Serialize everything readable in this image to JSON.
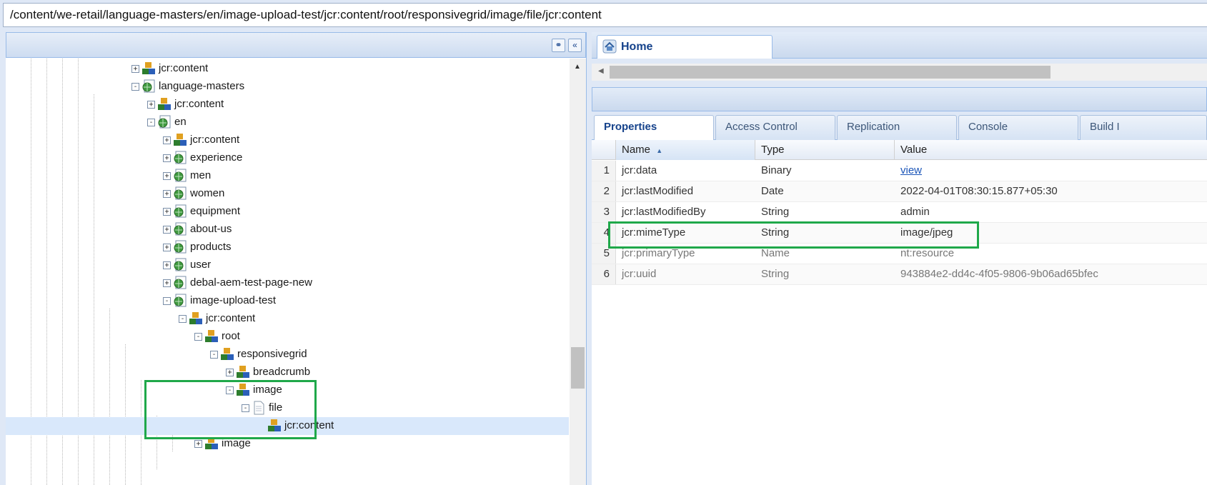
{
  "address_bar": {
    "path": "/content/we-retail/language-masters/en/image-upload-test/jcr:content/root/responsivegrid/image/file/jcr:content"
  },
  "left_panel": {
    "header_buttons": {
      "find_icon": "binoculars-icon",
      "collapse_icon": "double-chevron-left-icon"
    },
    "tree": [
      {
        "label": "jcr:content",
        "icon": "component-node-icon",
        "toggle": "+"
      },
      {
        "label": "language-masters",
        "icon": "page-icon",
        "toggle": "−"
      },
      {
        "label": "jcr:content",
        "icon": "component-node-icon",
        "toggle": "+"
      },
      {
        "label": "en",
        "icon": "page-icon",
        "toggle": "−"
      },
      {
        "label": "jcr:content",
        "icon": "component-node-icon",
        "toggle": "+"
      },
      {
        "label": "experience",
        "icon": "page-icon",
        "toggle": "+"
      },
      {
        "label": "men",
        "icon": "page-icon",
        "toggle": "+"
      },
      {
        "label": "women",
        "icon": "page-icon",
        "toggle": "+"
      },
      {
        "label": "equipment",
        "icon": "page-icon",
        "toggle": "+"
      },
      {
        "label": "about-us",
        "icon": "page-icon",
        "toggle": "+"
      },
      {
        "label": "products",
        "icon": "page-icon",
        "toggle": "+"
      },
      {
        "label": "user",
        "icon": "page-icon",
        "toggle": "+"
      },
      {
        "label": "debal-aem-test-page-new",
        "icon": "page-icon",
        "toggle": "+"
      },
      {
        "label": "image-upload-test",
        "icon": "page-icon",
        "toggle": "−"
      },
      {
        "label": "jcr:content",
        "icon": "component-node-icon",
        "toggle": "−"
      },
      {
        "label": "root",
        "icon": "component-node-icon",
        "toggle": "−"
      },
      {
        "label": "responsivegrid",
        "icon": "component-node-icon",
        "toggle": "−"
      },
      {
        "label": "breadcrumb",
        "icon": "component-node-icon",
        "toggle": "+"
      },
      {
        "label": "image",
        "icon": "component-node-icon",
        "toggle": "−"
      },
      {
        "label": "file",
        "icon": "file-icon",
        "toggle": "−"
      },
      {
        "label": "jcr:content",
        "icon": "component-node-icon",
        "toggle": "",
        "selected": true
      },
      {
        "label": "image",
        "icon": "component-node-icon",
        "toggle": "+"
      }
    ]
  },
  "right_panel": {
    "home_tab": {
      "label": "Home",
      "icon": "home-icon"
    },
    "tabs": [
      "Properties",
      "Access Control",
      "Replication",
      "Console",
      "Build I"
    ],
    "active_tab": "Properties",
    "columns": {
      "name": "Name",
      "type": "Type",
      "value": "Value"
    },
    "rows": [
      {
        "num": "1",
        "name": "jcr:data",
        "type": "Binary",
        "value": "view",
        "is_link": true
      },
      {
        "num": "2",
        "name": "jcr:lastModified",
        "type": "Date",
        "value": "2022-04-01T08:30:15.877+05:30"
      },
      {
        "num": "3",
        "name": "jcr:lastModifiedBy",
        "type": "String",
        "value": "admin"
      },
      {
        "num": "4",
        "name": "jcr:mimeType",
        "type": "String",
        "value": "image/jpeg"
      },
      {
        "num": "5",
        "name": "jcr:primaryType",
        "type": "Name",
        "value": "nt:resource",
        "dim": true
      },
      {
        "num": "6",
        "name": "jcr:uuid",
        "type": "String",
        "value": "943884e2-dd4c-4f05-9806-9b06ad65bfec",
        "dim": true
      }
    ]
  },
  "colors": {
    "highlight": "#1fa84a",
    "panel_header": "#15428b",
    "selected_row": "#d9e8fb"
  }
}
